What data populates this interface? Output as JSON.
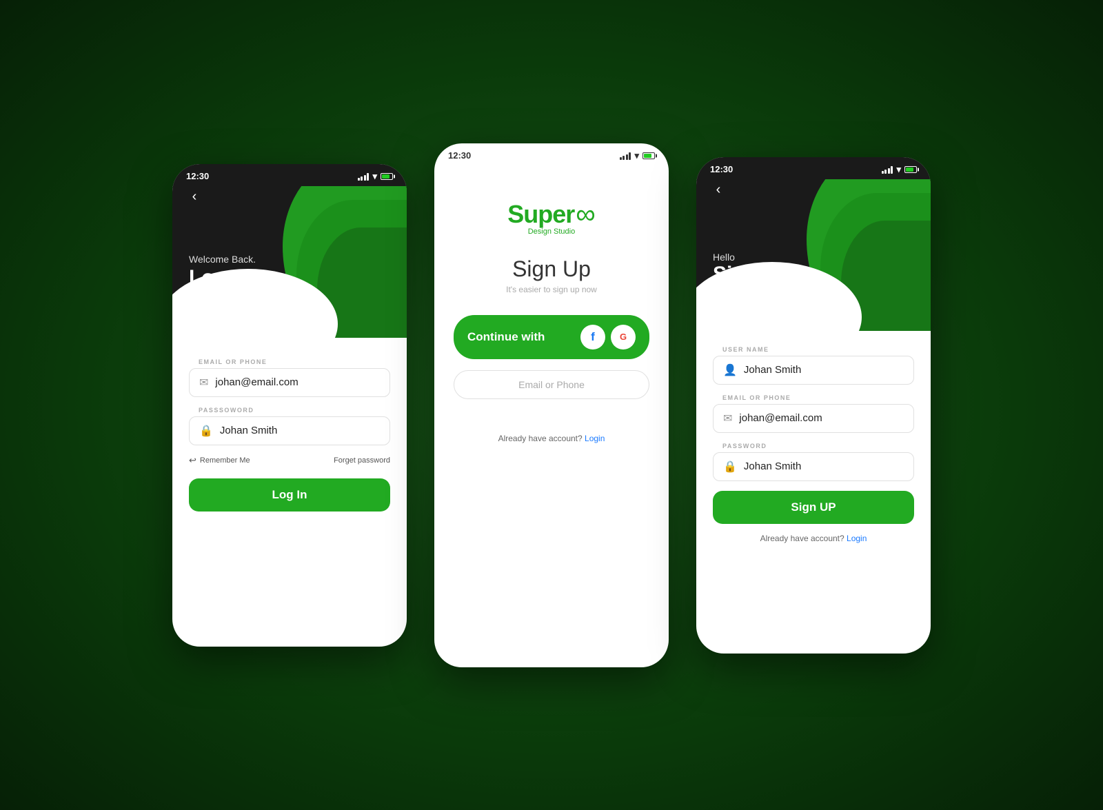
{
  "background": "#0a3a0a",
  "phones": {
    "left": {
      "statusBar": {
        "time": "12:30",
        "style": "dark"
      },
      "header": {
        "subtitle": "Welcome Back.",
        "title": "Log In!"
      },
      "fields": [
        {
          "label": "EMAIL OR PHONE",
          "icon": "envelope",
          "value": "johan@email.com"
        },
        {
          "label": "PASSSOWORD",
          "icon": "lock",
          "value": "Johan Smith"
        }
      ],
      "rememberMe": "Remember Me",
      "forgetPassword": "Forget password",
      "buttonLabel": "Log In"
    },
    "center": {
      "statusBar": {
        "time": "12:30",
        "style": "light"
      },
      "logo": {
        "text": "Super",
        "swish": "∞",
        "subtext": "Design Studio"
      },
      "title": "Sign Up",
      "subtitle": "It's easier to sign up now",
      "continueWith": "Continue with",
      "socialIcons": [
        "F",
        "G"
      ],
      "emailOrPhone": "Email or Phone",
      "alreadyText": "Already have account?",
      "loginLink": "Login"
    },
    "right": {
      "statusBar": {
        "time": "12:30",
        "style": "dark"
      },
      "header": {
        "subtitle": "Hello",
        "title": "Sign Up!"
      },
      "fields": [
        {
          "label": "USER NAME",
          "icon": "person",
          "value": "Johan Smith"
        },
        {
          "label": "EMAIL OR PHONE",
          "icon": "envelope",
          "value": "johan@email.com"
        },
        {
          "label": "PASSWORD",
          "icon": "lock",
          "value": "Johan Smith"
        }
      ],
      "buttonLabel": "Sign UP",
      "alreadyText": "Already have account?",
      "loginLink": "Login"
    }
  }
}
